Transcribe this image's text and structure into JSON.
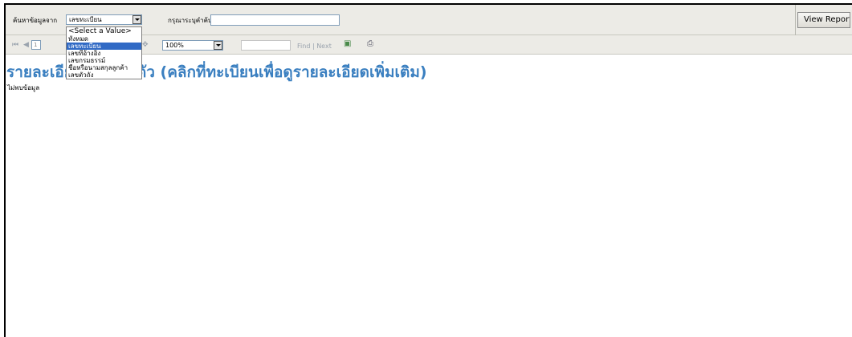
{
  "params": {
    "search_from_label": "ค้นหาข้อมูลจาก",
    "search_from_value": "เลขทะเบียน",
    "keyword_label": "กรุณาระบุคำค้น",
    "keyword_value": "",
    "view_report_label": "View Report"
  },
  "dropdown": {
    "options": [
      "<Select a Value>",
      "ทั้งหมด",
      "เลขทะเบียน",
      "เลขที่อ้างอิง",
      "เลขกรมธรรม์",
      "ชื่อหรือนามสกุลลูกค้า",
      "เลขตัวถัง"
    ],
    "selected": "เลขทะเบียน"
  },
  "toolbar": {
    "page_number": "1",
    "zoom": "100%",
    "find_label": "Find",
    "separator": "|",
    "next_label": "Next"
  },
  "report": {
    "title": "รายละเอียดตามเลขตัว (คลิกที่ทะเบียนเพื่อดูรายละเอียดเพิ่มเติม)",
    "empty_message": "ไม่พบข้อมูล"
  }
}
